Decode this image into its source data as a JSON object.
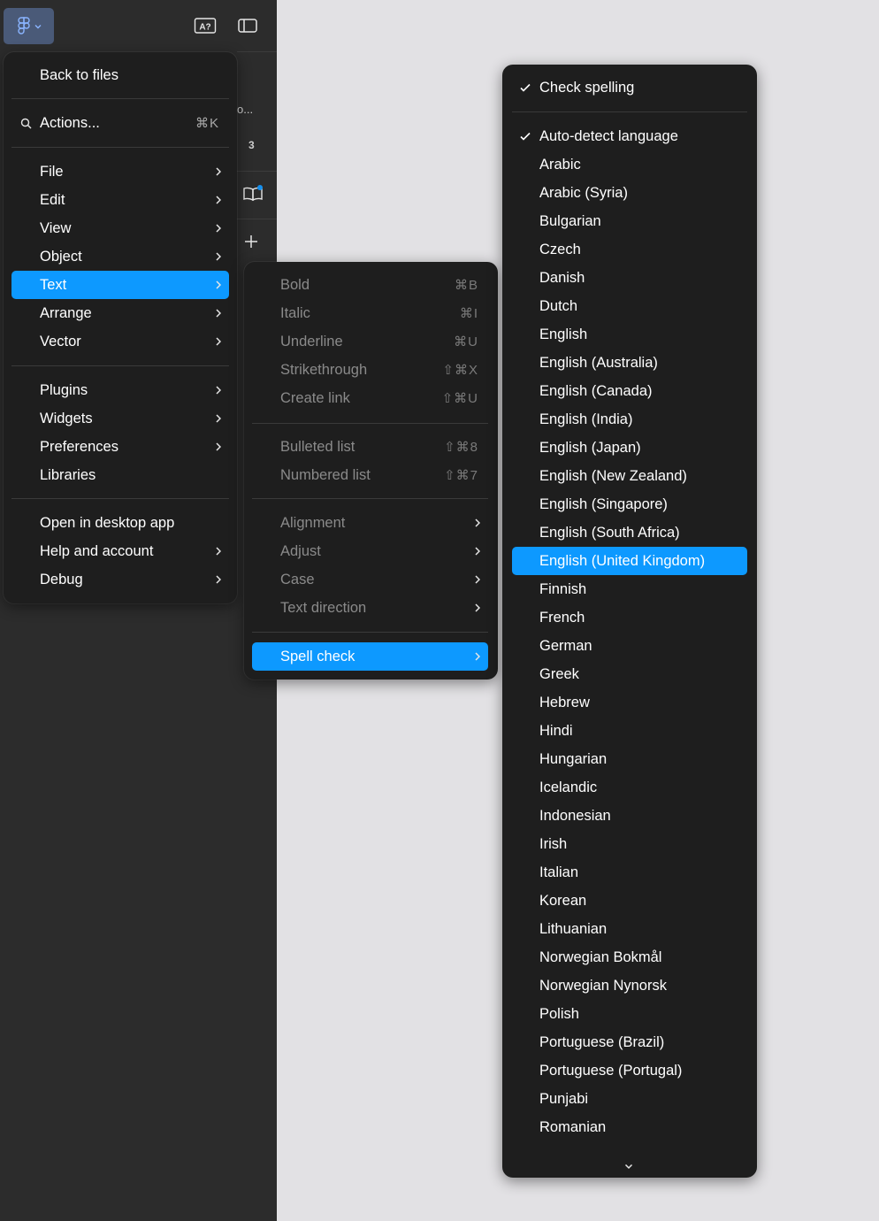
{
  "sidebar": {
    "peek_text_1": "o...",
    "peek_text_2": "3"
  },
  "main_menu": {
    "back_to_files": "Back to files",
    "actions": {
      "label": "Actions...",
      "shortcut": "⌘K"
    },
    "group1": [
      "File",
      "Edit",
      "View",
      "Object",
      "Text",
      "Arrange",
      "Vector"
    ],
    "group2": [
      "Plugins",
      "Widgets",
      "Preferences",
      "Libraries"
    ],
    "group3": [
      "Open in desktop app",
      "Help and account",
      "Debug"
    ],
    "active_item": "Text"
  },
  "text_menu": {
    "format": [
      {
        "label": "Bold",
        "shortcut": "⌘B"
      },
      {
        "label": "Italic",
        "shortcut": "⌘I"
      },
      {
        "label": "Underline",
        "shortcut": "⌘U"
      },
      {
        "label": "Strikethrough",
        "shortcut": "⇧⌘X"
      },
      {
        "label": "Create link",
        "shortcut": "⇧⌘U"
      }
    ],
    "lists": [
      {
        "label": "Bulleted list",
        "shortcut": "⇧⌘8"
      },
      {
        "label": "Numbered list",
        "shortcut": "⇧⌘7"
      }
    ],
    "submenus": [
      "Alignment",
      "Adjust",
      "Case",
      "Text direction"
    ],
    "spell_check": "Spell check"
  },
  "spell_menu": {
    "check_spelling": "Check spelling",
    "auto_detect": "Auto-detect language",
    "languages": [
      "Arabic",
      "Arabic (Syria)",
      "Bulgarian",
      "Czech",
      "Danish",
      "Dutch",
      "English",
      "English (Australia)",
      "English (Canada)",
      "English (India)",
      "English (Japan)",
      "English (New Zealand)",
      "English (Singapore)",
      "English (South Africa)",
      "English (United Kingdom)",
      "Finnish",
      "French",
      "German",
      "Greek",
      "Hebrew",
      "Hindi",
      "Hungarian",
      "Icelandic",
      "Indonesian",
      "Irish",
      "Italian",
      "Korean",
      "Lithuanian",
      "Norwegian Bokmål",
      "Norwegian Nynorsk",
      "Polish",
      "Portuguese (Brazil)",
      "Portuguese (Portugal)",
      "Punjabi",
      "Romanian"
    ],
    "selected_language": "English (United Kingdom)"
  },
  "colors": {
    "accent": "#0d99ff",
    "menu_bg": "#1e1e1e",
    "sidebar_bg": "#2c2c2c",
    "canvas_bg": "#e2e1e4",
    "disabled_text": "#8a8a8a"
  },
  "icons": {
    "logo": "figma-logo-icon",
    "ai": "text-ai-icon",
    "panel": "sidebar-toggle-icon",
    "library": "book-icon",
    "add": "plus-icon",
    "search": "search-icon",
    "chevron": "chevron-right-icon",
    "check": "checkmark-icon",
    "scroll": "chevron-down-icon"
  }
}
